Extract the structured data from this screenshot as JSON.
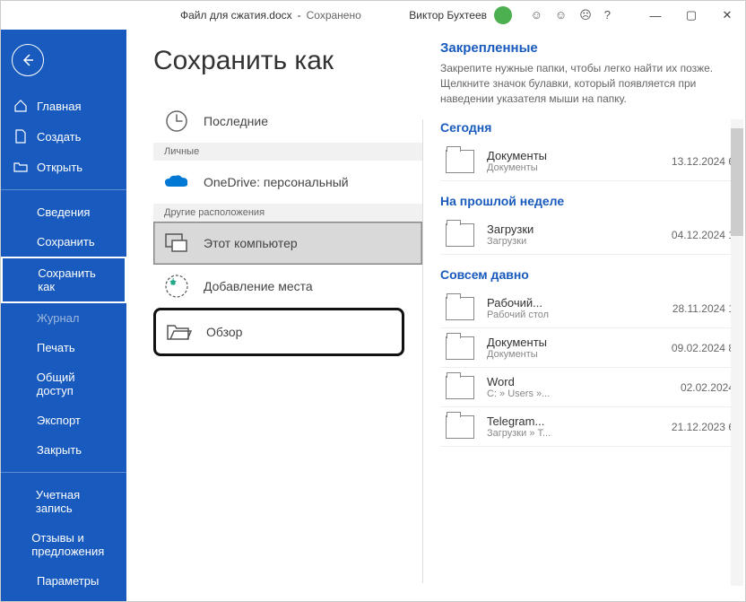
{
  "title": {
    "filename": "Файл для сжатия.docx",
    "sep": "-",
    "status": "Сохранено"
  },
  "user": {
    "name": "Виктор Бухтеев"
  },
  "sidebar": {
    "home": "Главная",
    "new": "Создать",
    "open": "Открыть",
    "info": "Сведения",
    "save": "Сохранить",
    "saveas": "Сохранить как",
    "history": "Журнал",
    "print": "Печать",
    "share": "Общий доступ",
    "export": "Экспорт",
    "close": "Закрыть",
    "account": "Учетная запись",
    "feedback": "Отзывы и предложения",
    "options": "Параметры"
  },
  "page": {
    "heading": "Сохранить как"
  },
  "locations": {
    "recent": "Последние",
    "group_personal": "Личные",
    "onedrive": "OneDrive: персональный",
    "onedrive_sub": "",
    "group_other": "Другие расположения",
    "thispc": "Этот компьютер",
    "addplace": "Добавление места",
    "browse": "Обзор"
  },
  "right": {
    "pinned_title": "Закрепленные",
    "pinned_desc": "Закрепите нужные папки, чтобы легко найти их позже. Щелкните значок булавки, который появляется при наведении указателя мыши на папку.",
    "groups": [
      {
        "label": "Сегодня",
        "items": [
          {
            "name": "Документы",
            "path": "Документы",
            "date": "13.12.2024 6"
          }
        ]
      },
      {
        "label": "На прошлой неделе",
        "items": [
          {
            "name": "Загрузки",
            "path": "Загрузки",
            "date": "04.12.2024 1"
          }
        ]
      },
      {
        "label": "Совсем давно",
        "items": [
          {
            "name": "Рабочий...",
            "path": "Рабочий стол",
            "date": "28.11.2024 1"
          },
          {
            "name": "Документы",
            "path": "Документы",
            "date": "09.02.2024 8"
          },
          {
            "name": "Word",
            "path": "C: » Users »...",
            "date": "02.02.2024"
          },
          {
            "name": "Telegram...",
            "path": "Загрузки » T...",
            "date": "21.12.2023 6"
          }
        ]
      }
    ]
  }
}
